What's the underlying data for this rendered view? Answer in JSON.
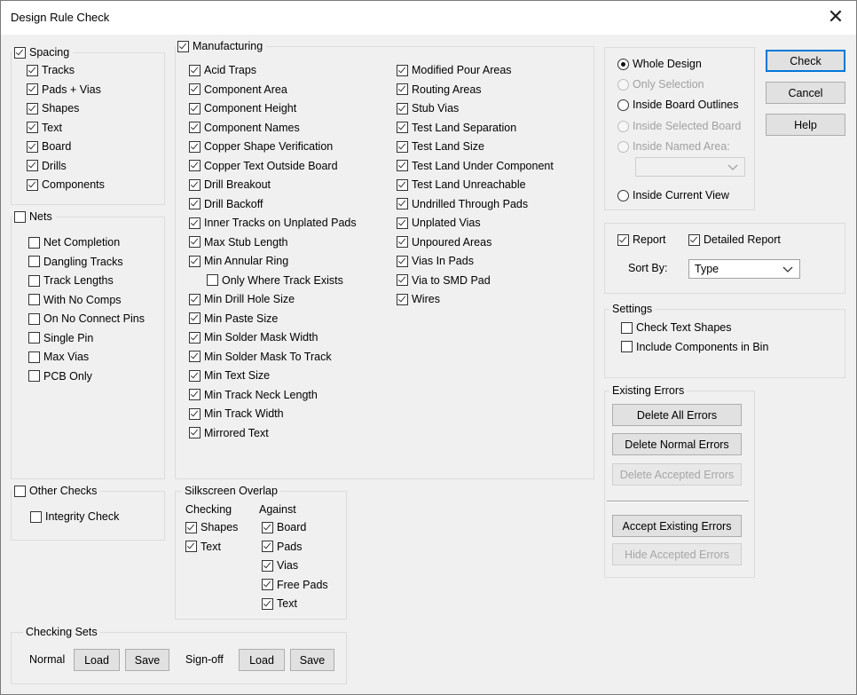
{
  "window": {
    "title": "Design Rule Check",
    "close_glyph": "✕"
  },
  "spacing": {
    "label": "Spacing",
    "checked": true,
    "items": [
      {
        "label": "Tracks",
        "checked": true
      },
      {
        "label": "Pads + Vias",
        "checked": true
      },
      {
        "label": "Shapes",
        "checked": true
      },
      {
        "label": "Text",
        "checked": true
      },
      {
        "label": "Board",
        "checked": true
      },
      {
        "label": "Drills",
        "checked": true
      },
      {
        "label": "Components",
        "checked": true
      }
    ]
  },
  "nets": {
    "label": "Nets",
    "checked": false,
    "items": [
      {
        "label": "Net Completion",
        "checked": false
      },
      {
        "label": "Dangling Tracks",
        "checked": false
      },
      {
        "label": "Track Lengths",
        "checked": false
      },
      {
        "label": "With No Comps",
        "checked": false
      },
      {
        "label": "On No Connect Pins",
        "checked": false
      },
      {
        "label": "Single Pin",
        "checked": false
      },
      {
        "label": "Max Vias",
        "checked": false
      },
      {
        "label": "PCB Only",
        "checked": false
      }
    ]
  },
  "other_checks": {
    "label": "Other Checks",
    "checked": false,
    "items": [
      {
        "label": "Integrity Check",
        "checked": false
      }
    ]
  },
  "manufacturing": {
    "label": "Manufacturing",
    "checked": true,
    "col1": [
      {
        "label": "Acid Traps",
        "checked": true
      },
      {
        "label": "Component Area",
        "checked": true
      },
      {
        "label": "Component Height",
        "checked": true
      },
      {
        "label": "Component Names",
        "checked": true
      },
      {
        "label": "Copper Shape Verification",
        "checked": true
      },
      {
        "label": "Copper Text Outside Board",
        "checked": true
      },
      {
        "label": "Drill Breakout",
        "checked": true
      },
      {
        "label": "Drill Backoff",
        "checked": true
      },
      {
        "label": "Inner Tracks on Unplated Pads",
        "checked": true
      },
      {
        "label": "Max Stub Length",
        "checked": true
      },
      {
        "label": "Min Annular Ring",
        "checked": true
      },
      {
        "label": "Only Where Track Exists",
        "checked": false
      },
      {
        "label": "Min Drill Hole Size",
        "checked": true
      },
      {
        "label": "Min Paste Size",
        "checked": true
      },
      {
        "label": "Min Solder Mask Width",
        "checked": true
      },
      {
        "label": "Min Solder Mask To Track",
        "checked": true
      },
      {
        "label": "Min Text Size",
        "checked": true
      },
      {
        "label": "Min Track Neck Length",
        "checked": true
      },
      {
        "label": "Min Track Width",
        "checked": true
      },
      {
        "label": "Mirrored Text",
        "checked": true
      }
    ],
    "col2": [
      {
        "label": "Modified Pour Areas",
        "checked": true
      },
      {
        "label": "Routing Areas",
        "checked": true
      },
      {
        "label": "Stub Vias",
        "checked": true
      },
      {
        "label": "Test Land Separation",
        "checked": true
      },
      {
        "label": "Test Land Size",
        "checked": true
      },
      {
        "label": "Test Land Under Component",
        "checked": true
      },
      {
        "label": "Test Land Unreachable",
        "checked": true
      },
      {
        "label": "Undrilled Through Pads",
        "checked": true
      },
      {
        "label": "Unplated Vias",
        "checked": true
      },
      {
        "label": "Unpoured Areas",
        "checked": true
      },
      {
        "label": "Vias In Pads",
        "checked": true
      },
      {
        "label": "Via to SMD Pad",
        "checked": true
      },
      {
        "label": "Wires",
        "checked": true
      }
    ]
  },
  "silkscreen": {
    "label": "Silkscreen Overlap",
    "checking_label": "Checking",
    "against_label": "Against",
    "checking": [
      {
        "label": "Shapes",
        "checked": true
      },
      {
        "label": "Text",
        "checked": true
      }
    ],
    "against": [
      {
        "label": "Board",
        "checked": true
      },
      {
        "label": "Pads",
        "checked": true
      },
      {
        "label": "Vias",
        "checked": true
      },
      {
        "label": "Free Pads",
        "checked": true
      },
      {
        "label": "Text",
        "checked": true
      }
    ]
  },
  "checking_sets": {
    "label": "Checking Sets",
    "normal_label": "Normal",
    "signoff_label": "Sign-off",
    "load": "Load",
    "save": "Save"
  },
  "scope": {
    "options": [
      {
        "label": "Whole Design",
        "selected": true,
        "enabled": true
      },
      {
        "label": "Only Selection",
        "selected": false,
        "enabled": false
      },
      {
        "label": "Inside Board Outlines",
        "selected": false,
        "enabled": true
      },
      {
        "label": "Inside Selected Board",
        "selected": false,
        "enabled": false
      },
      {
        "label": "Inside Named Area:",
        "selected": false,
        "enabled": false
      },
      {
        "label": "Inside Current View",
        "selected": false,
        "enabled": true
      }
    ],
    "named_area_value": ""
  },
  "buttons": {
    "check": "Check",
    "cancel": "Cancel",
    "help": "Help"
  },
  "report": {
    "report_label": "Report",
    "report_checked": true,
    "detailed_label": "Detailed Report",
    "detailed_checked": true,
    "sort_label": "Sort By:",
    "sort_value": "Type"
  },
  "settings": {
    "label": "Settings",
    "items": [
      {
        "label": "Check Text Shapes",
        "checked": false
      },
      {
        "label": "Include Components in Bin",
        "checked": false
      }
    ]
  },
  "errors": {
    "label": "Existing Errors",
    "delete_all": "Delete All Errors",
    "delete_normal": "Delete Normal Errors",
    "delete_accepted": "Delete Accepted Errors",
    "accept_existing": "Accept Existing Errors",
    "hide_accepted": "Hide Accepted Errors"
  }
}
